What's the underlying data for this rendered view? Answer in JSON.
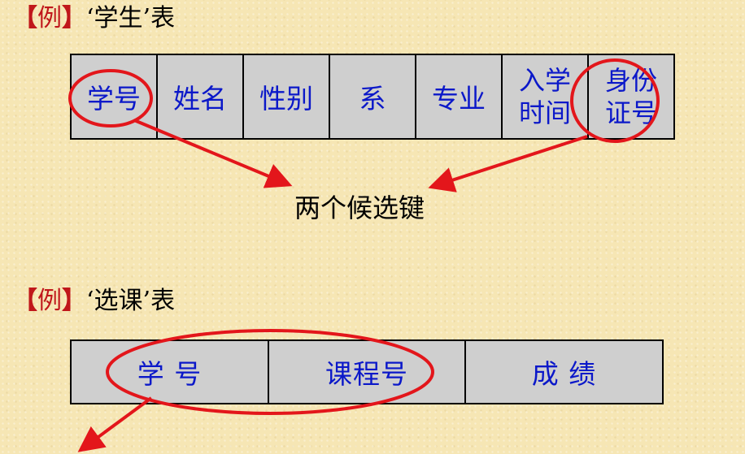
{
  "example1": {
    "bracket_left": "【",
    "label": "例",
    "bracket_right": "】",
    "title": "‘学生’表"
  },
  "table1": {
    "columns": [
      "学号",
      "姓名",
      "性别",
      "系",
      "专业",
      "入学\n时间",
      "身份\n证号"
    ]
  },
  "annotation": {
    "text": "两个候选键"
  },
  "example2": {
    "bracket_left": "【",
    "label": "例",
    "bracket_right": "】",
    "title": "‘选课’表"
  },
  "table2": {
    "columns": [
      "学 号",
      "课程号",
      "成 绩"
    ]
  },
  "colors": {
    "background": "#f6e6b4",
    "table_fill": "#cfcfcf",
    "header_text": "#0b18c9",
    "highlight": "#e3161b"
  }
}
